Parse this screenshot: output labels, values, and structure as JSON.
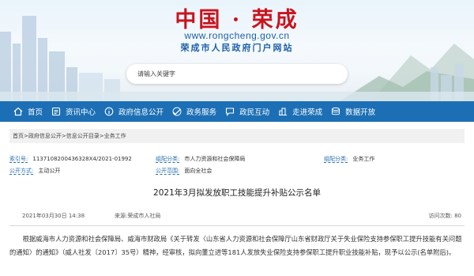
{
  "header": {
    "title": "中国 · 荣成",
    "url": "www.rongcheng.gov.cn",
    "subtitle": "荣成市人民政府门户网站"
  },
  "search": {
    "placeholder": "请输入关键字"
  },
  "nav": {
    "items": [
      {
        "label": "首页",
        "icon": "home-icon"
      },
      {
        "label": "资讯中心",
        "icon": "news-icon"
      },
      {
        "label": "政府信息公开",
        "icon": "info-icon"
      },
      {
        "label": "政务服务",
        "icon": "service-icon"
      },
      {
        "label": "政民互动",
        "icon": "chat-icon"
      },
      {
        "label": "走进荣成",
        "icon": "city-icon"
      },
      {
        "label": "数据开放",
        "icon": "data-icon"
      }
    ]
  },
  "breadcrumb": {
    "text": "首页>政府信息公开>信息公开目录>业务工作"
  },
  "meta": {
    "index_label": "索引号:",
    "index_value": "11371082004363​28X4/2021-01992",
    "org_label": "组配分类:",
    "org_value": "市人力资源和社会保障局",
    "category_label": "组配分类:",
    "category_value": "业务工作",
    "open_label": "公开方式:",
    "open_value": "主动公开",
    "scope_label": "公开范围:",
    "scope_value": "面向全社会"
  },
  "article": {
    "title": "2021年3月拟发放职工技能提升补贴公示名单",
    "date": "2021年03月30日 14:38",
    "source_label": "来源:",
    "source_value": "荣成市人社局",
    "views": "访问次数: 80",
    "body": "根据威海市人力资源和社会保障局、威海市财政局《关于转发〈山东省人力资源和社会保障厅山东省财政厅关于失业保险支持参保职工提升技能有关问题的通知〉的通知》（威人社发〔2017〕35号）精神，经审核，拟向董立进等181人发放失业保险支持参保职工提升职业技能补贴，现予以公示(名单附后)。"
  },
  "colors": {
    "brand_red": "#c8141e",
    "brand_blue": "#1c6fb5",
    "link_blue": "#2a6fb0"
  }
}
